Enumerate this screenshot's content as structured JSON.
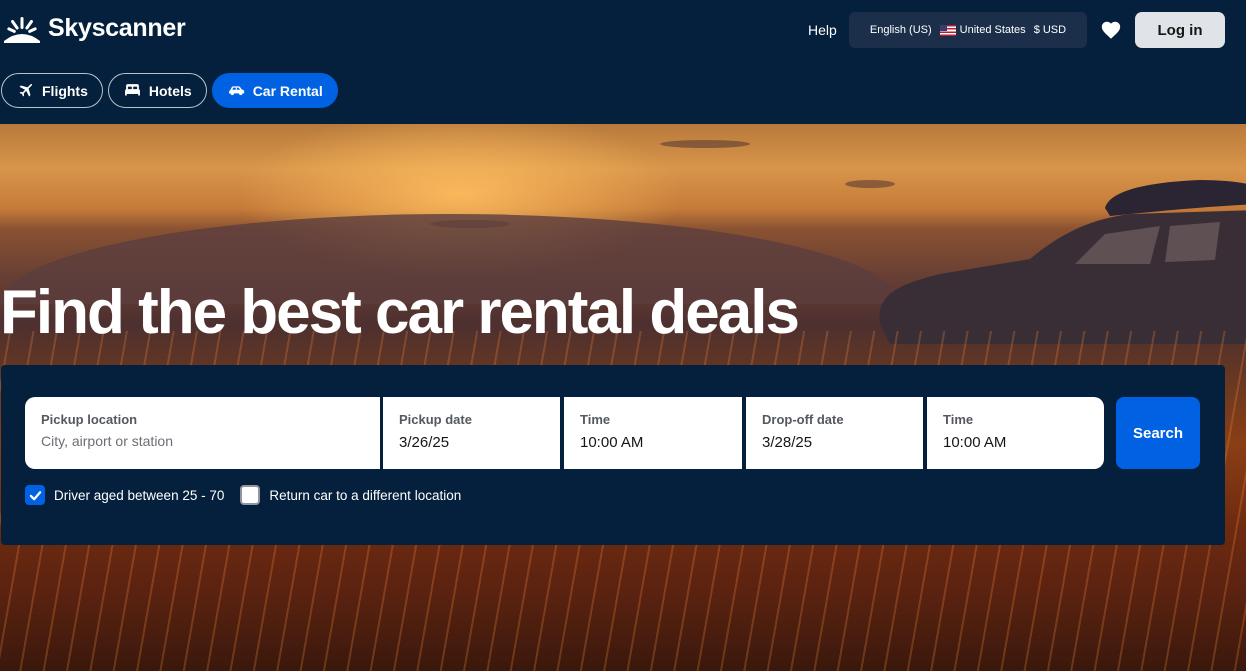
{
  "header": {
    "brand": "Skyscanner",
    "help": "Help",
    "locale": {
      "language": "English (US)",
      "country": "United States",
      "currency": "$ USD"
    },
    "login": "Log in"
  },
  "tabs": [
    {
      "label": "Flights",
      "icon": "airplane-icon",
      "active": false
    },
    {
      "label": "Hotels",
      "icon": "bed-icon",
      "active": false
    },
    {
      "label": "Car Rental",
      "icon": "car-icon",
      "active": true
    }
  ],
  "hero": {
    "headline": "Find the best car rental deals"
  },
  "search": {
    "pickup_location": {
      "label": "Pickup location",
      "placeholder": "City, airport or station",
      "value": ""
    },
    "pickup_date": {
      "label": "Pickup date",
      "value": "3/26/25"
    },
    "pickup_time": {
      "label": "Time",
      "value": "10:00 AM"
    },
    "dropoff_date": {
      "label": "Drop-off date",
      "value": "3/28/25"
    },
    "dropoff_time": {
      "label": "Time",
      "value": "10:00 AM"
    },
    "button": "Search",
    "driver_age": {
      "label": "Driver aged between 25 - 70",
      "checked": true
    },
    "return_different": {
      "label": "Return car to a different location",
      "checked": false
    }
  },
  "colors": {
    "navy": "#05203c",
    "accent": "#0062e3",
    "login_bg": "#e0e4e9"
  }
}
